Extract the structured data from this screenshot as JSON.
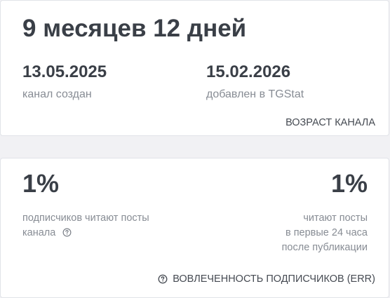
{
  "channel_age": {
    "duration": "9 месяцев 12 дней",
    "created_date": "13.05.2025",
    "created_caption": "канал создан",
    "added_date": "15.02.2026",
    "added_caption": "добавлен в TGStat",
    "footer_label": "ВОЗРАСТ КАНАЛА"
  },
  "engagement": {
    "left_percent": "1%",
    "left_caption_line1": "подписчиков читают посты",
    "left_caption_line2": "канала",
    "right_percent": "1%",
    "right_caption_line1": "читают посты",
    "right_caption_line2": "в первые 24 часа",
    "right_caption_line3": "после публикации",
    "footer_label": "ВОВЛЕЧЕННОСТЬ ПОДПИСЧИКОВ (ERR)"
  },
  "icons": {
    "help": "question-circle-icon"
  },
  "colors": {
    "heading": "#3a3f47",
    "muted": "#878c94",
    "card_bg": "#ffffff",
    "page_bg": "#f1f1f4"
  }
}
